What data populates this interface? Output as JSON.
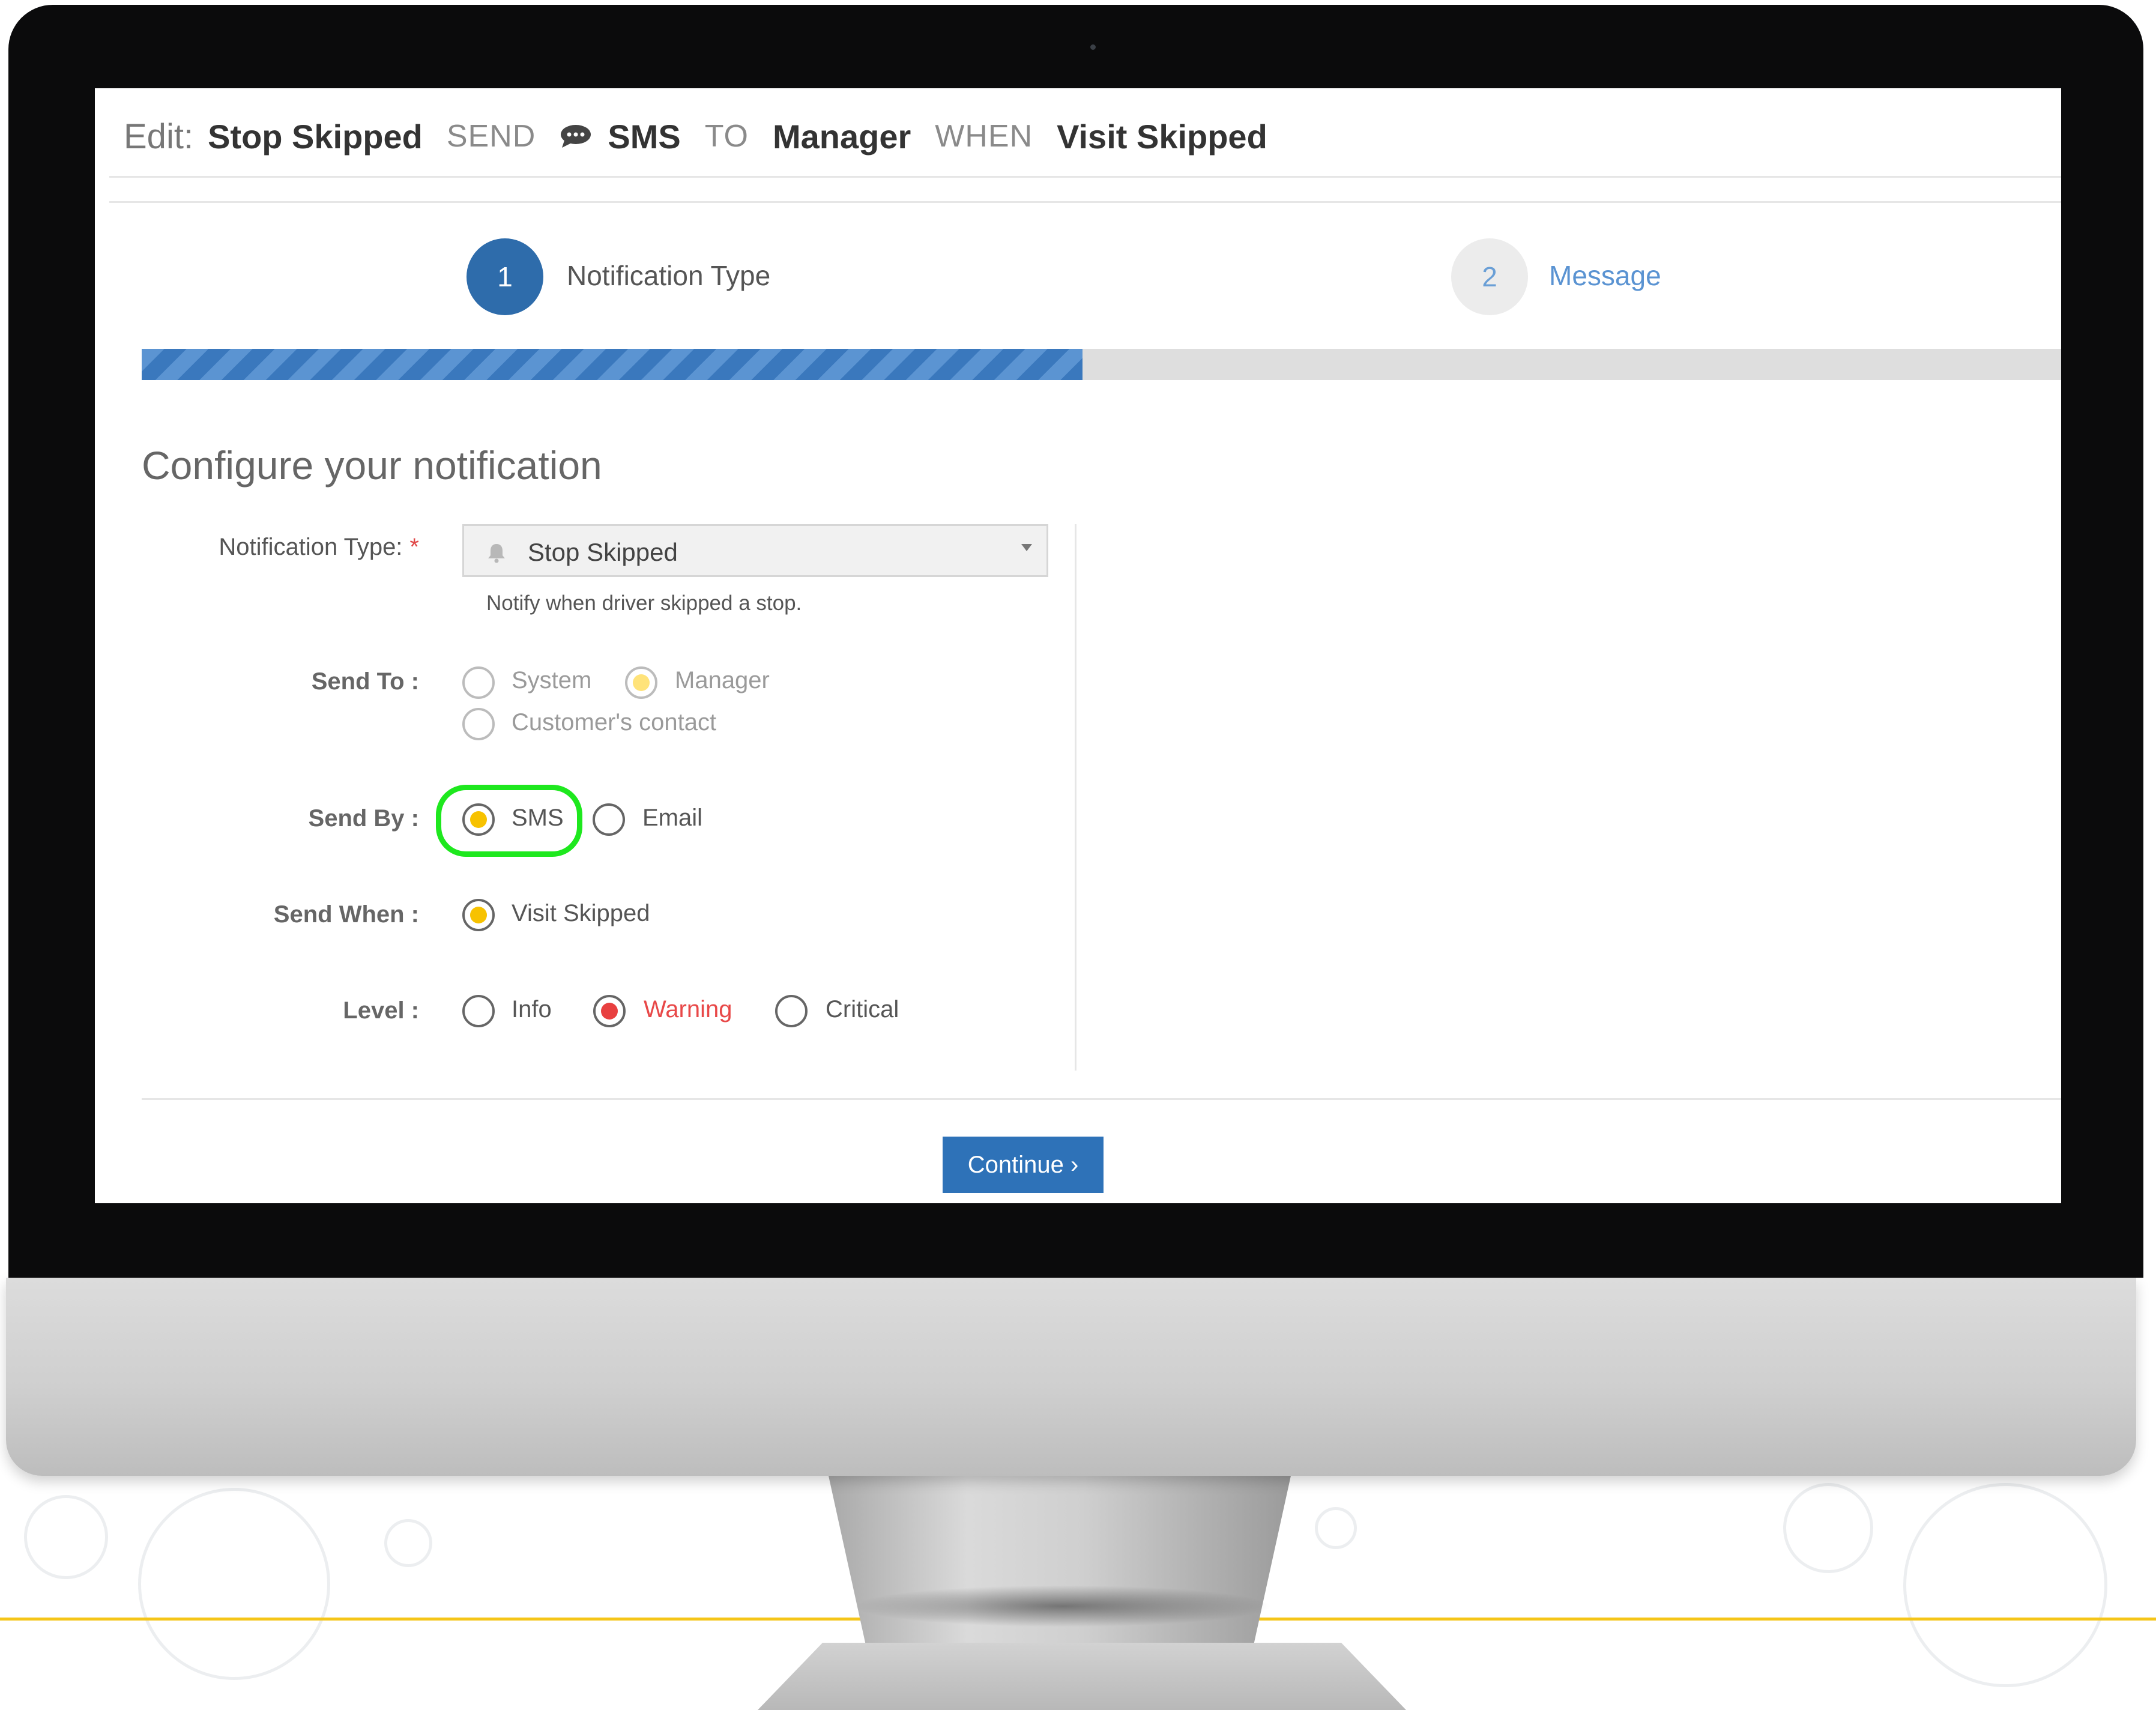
{
  "title_bar": {
    "edit_label": "Edit:",
    "notification_name": "Stop Skipped",
    "send_keyword": "SEND",
    "channel": "SMS",
    "to_keyword": "TO",
    "recipient": "Manager",
    "when_keyword": "WHEN",
    "trigger": "Visit Skipped"
  },
  "steps": [
    {
      "number": "1",
      "label": "Notification Type",
      "state": "active"
    },
    {
      "number": "2",
      "label": "Message",
      "state": "pending"
    }
  ],
  "progress": {
    "fraction": 0.49
  },
  "form": {
    "heading": "Configure your notification",
    "notification_type": {
      "label": "Notification Type:",
      "required_mark": "*",
      "selected": "Stop Skipped",
      "icon": "bell-icon",
      "hint": "Notify when driver skipped a stop."
    },
    "send_to": {
      "label": "Send To :",
      "options": [
        "System",
        "Manager",
        "Customer's contact"
      ],
      "selected": "Manager"
    },
    "send_by": {
      "label": "Send By :",
      "options": [
        "SMS",
        "Email"
      ],
      "selected": "SMS"
    },
    "send_when": {
      "label": "Send When :",
      "options": [
        "Visit Skipped"
      ],
      "selected": "Visit Skipped"
    },
    "level": {
      "label": "Level :",
      "options": [
        "Info",
        "Warning",
        "Critical"
      ],
      "selected": "Warning"
    }
  },
  "continue_button": {
    "label": "Continue ›"
  },
  "colors": {
    "primary": "#2e6cab",
    "radio_selected": "#f7c200",
    "warning": "#e84848",
    "highlight": "#1ee81e",
    "accent_line": "#f5c518"
  }
}
